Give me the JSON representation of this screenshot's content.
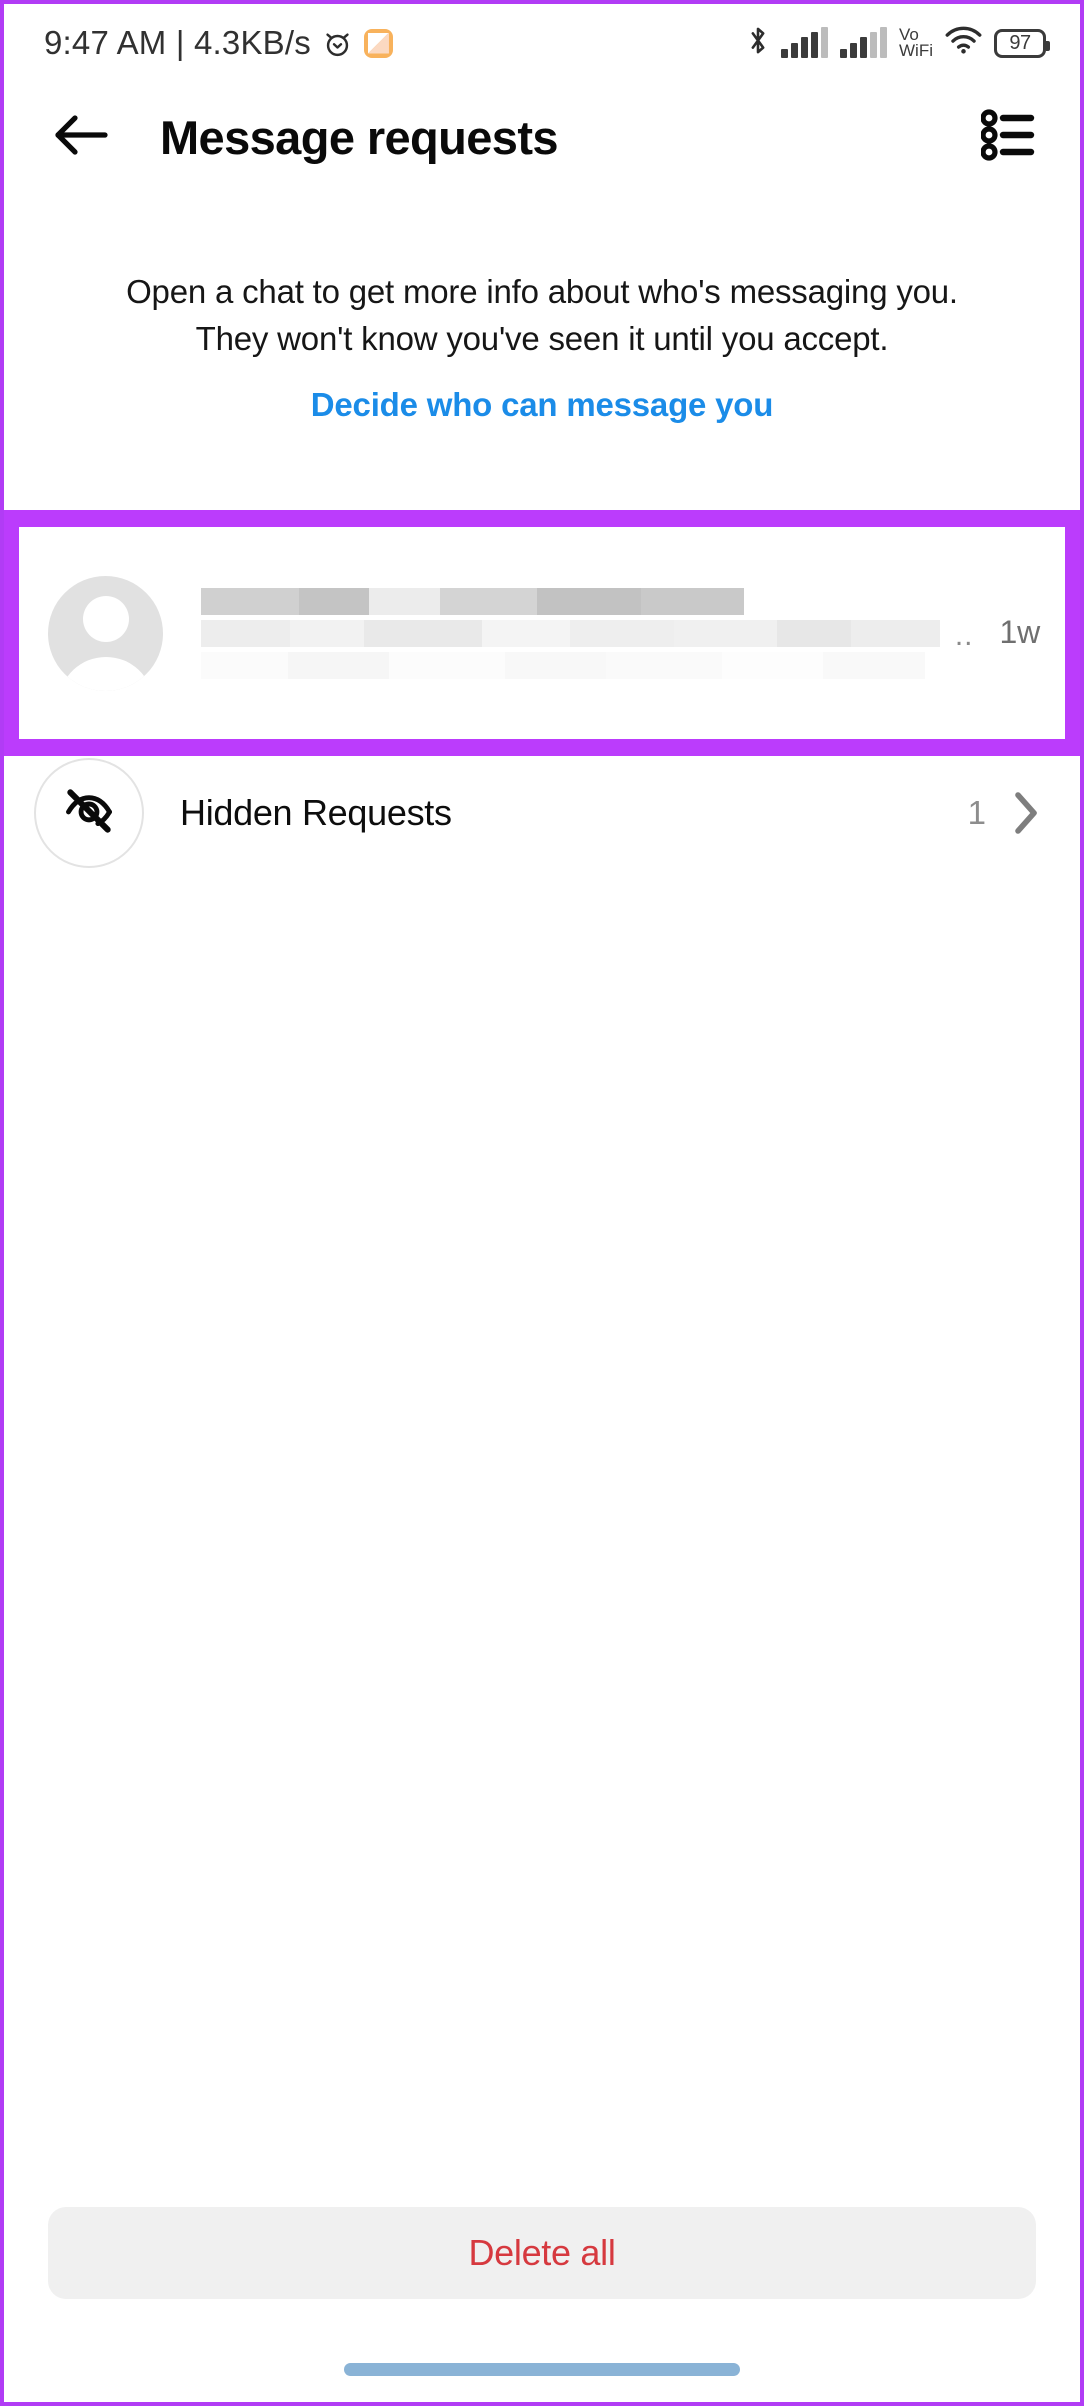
{
  "status_bar": {
    "clock": "9:47 AM | 4.3KB/s",
    "alarm_icon": "alarm-clock-icon",
    "app_badge_icon": "notes-app-icon",
    "bluetooth_icon": "bluetooth-icon",
    "sim1_icon": "signal-bars-sim1-icon",
    "sim2_icon": "signal-bars-sim2-icon",
    "vowifi_line1": "Vo",
    "vowifi_line2": "WiFi",
    "wifi_icon": "wifi-icon",
    "battery_level": "97"
  },
  "header": {
    "back_icon": "arrow-left-icon",
    "title": "Message requests",
    "menu_icon": "list-menu-icon"
  },
  "info": {
    "description": "Open a chat to get more info about who's messaging you. They won't know you've seen it until you accept.",
    "link_label": "Decide who can message you",
    "link_color": "#1b8ce8"
  },
  "annotation": {
    "highlight_color": "#bb3cfc",
    "highlight_target": "message-request-row"
  },
  "request": {
    "avatar_icon": "default-avatar-icon",
    "name_redacted": true,
    "preview_redacted": true,
    "ellipsis": "..",
    "time_ago": "1w",
    "redact_blocks": {
      "name": [
        "#d0d0d0",
        "#c4c4c4",
        "#ececec",
        "#d4d4d4",
        "#c2c2c2",
        "#c9c9c9"
      ],
      "line1": [
        "#ededed",
        "#f2f2f2",
        "#e9e9e9",
        "#f4f4f4",
        "#eeeeee",
        "#f0f0f0",
        "#e7e7e7",
        "#ededed"
      ],
      "line2": [
        "#fbfbfb",
        "#f6f6f6",
        "#fcfcfc",
        "#f8f8f8",
        "#fafafa",
        "#fdfdfd",
        "#f9f9f9"
      ]
    }
  },
  "hidden_requests": {
    "icon": "eye-off-icon",
    "label": "Hidden Requests",
    "count": "1",
    "chevron_icon": "chevron-right-icon"
  },
  "footer": {
    "delete_all_label": "Delete all",
    "delete_all_color": "#d6393f",
    "home_indicator_color": "#8ab3d6"
  }
}
